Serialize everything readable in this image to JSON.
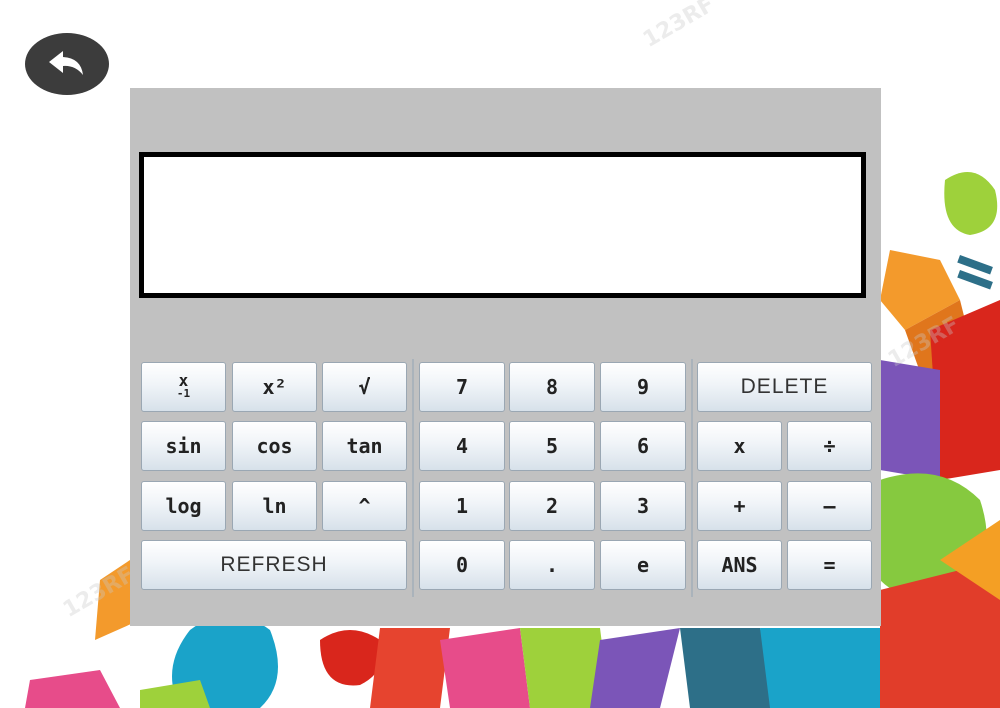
{
  "display": {
    "value": ""
  },
  "back_button": {
    "icon": "back-arrow-icon"
  },
  "scientific_keys": [
    {
      "id": "x-inverse",
      "label": "x",
      "sub": "-1"
    },
    {
      "id": "x-squared",
      "label": "x²"
    },
    {
      "id": "sqrt",
      "label": "√"
    },
    {
      "id": "sin",
      "label": "sin"
    },
    {
      "id": "cos",
      "label": "cos"
    },
    {
      "id": "tan",
      "label": "tan"
    },
    {
      "id": "log",
      "label": "log"
    },
    {
      "id": "ln",
      "label": "ln"
    },
    {
      "id": "power",
      "label": "^"
    }
  ],
  "refresh": {
    "label": "REFRESH"
  },
  "number_keys": [
    "7",
    "8",
    "9",
    "4",
    "5",
    "6",
    "1",
    "2",
    "3",
    "0",
    ".",
    "e"
  ],
  "delete": {
    "label": "DELETE"
  },
  "operator_keys": [
    {
      "id": "multiply",
      "label": "x"
    },
    {
      "id": "divide",
      "label": "÷"
    },
    {
      "id": "plus",
      "label": "+"
    },
    {
      "id": "minus",
      "label": "–"
    },
    {
      "id": "ans",
      "label": "ANS"
    },
    {
      "id": "equals",
      "label": "="
    }
  ],
  "watermark": {
    "text": "123RF"
  },
  "colors": {
    "panel": "#c1c1c1",
    "display_border": "#000000",
    "back_button": "#3c3c3c"
  }
}
